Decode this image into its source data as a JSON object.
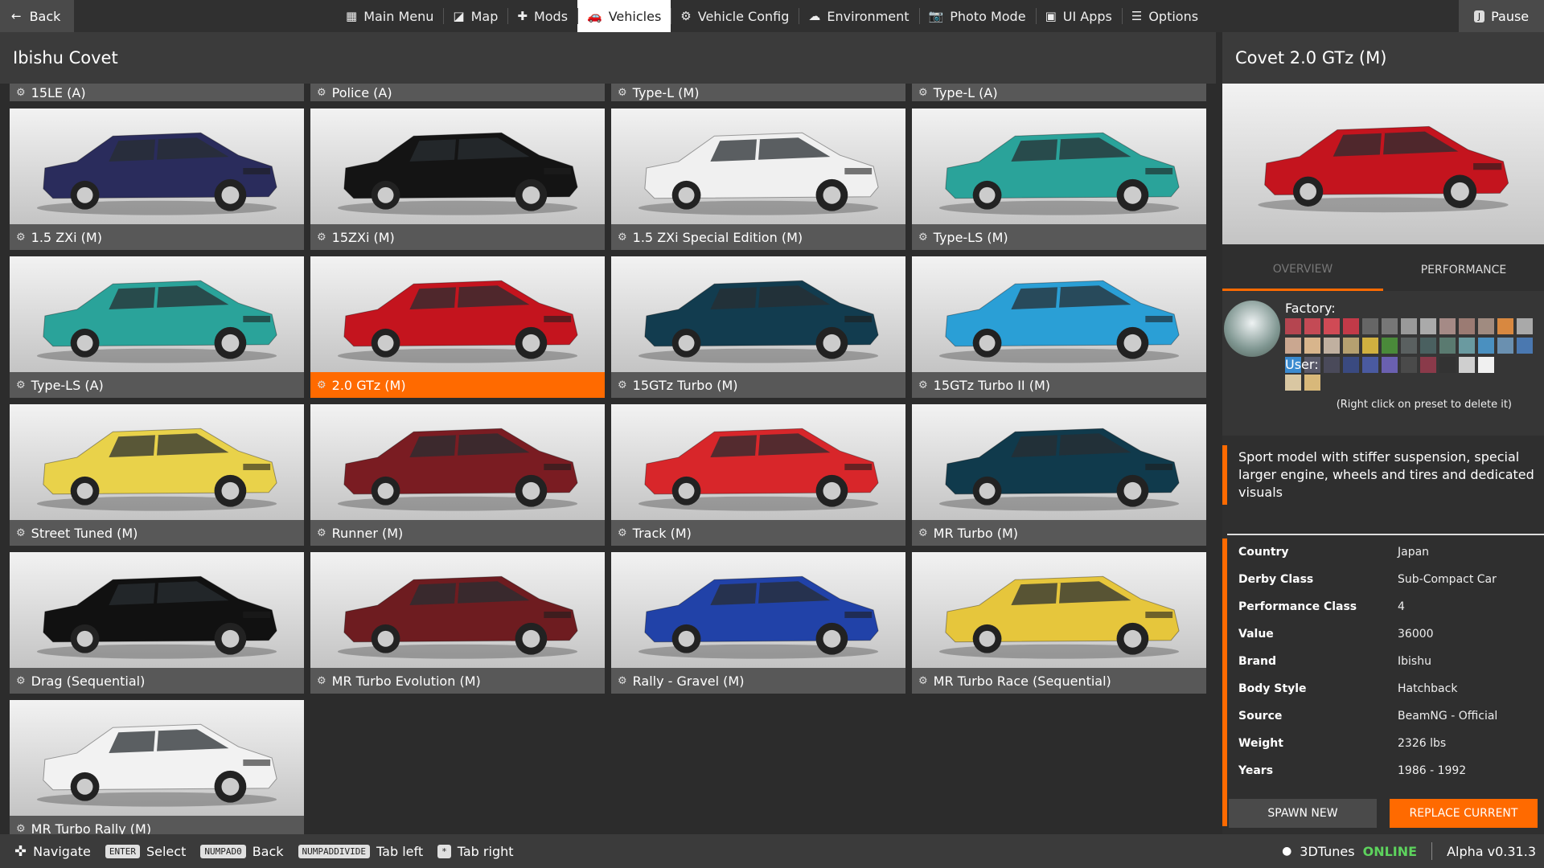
{
  "topbar": {
    "back_label": "Back",
    "pause_label": "Pause",
    "pause_key": "J",
    "tabs": [
      {
        "label": "Main Menu",
        "icon": "grid-icon",
        "glyph": "▦"
      },
      {
        "label": "Map",
        "icon": "map-icon",
        "glyph": "◪"
      },
      {
        "label": "Mods",
        "icon": "puzzle-icon",
        "glyph": "✚"
      },
      {
        "label": "Vehicles",
        "icon": "car-icon",
        "glyph": "🚗"
      },
      {
        "label": "Vehicle Config",
        "icon": "engine-icon",
        "glyph": "⚙"
      },
      {
        "label": "Environment",
        "icon": "weather-icon",
        "glyph": "☁"
      },
      {
        "label": "Photo Mode",
        "icon": "camera-icon",
        "glyph": "📷"
      },
      {
        "label": "UI Apps",
        "icon": "apps-icon",
        "glyph": "▣"
      },
      {
        "label": "Options",
        "icon": "sliders-icon",
        "glyph": "☰"
      }
    ]
  },
  "panel": {
    "title": "Ibishu Covet"
  },
  "configs": [
    {
      "name": "15LE (A)",
      "color": "#8a8a8a"
    },
    {
      "name": "Police (A)",
      "color": "#8a8a8a"
    },
    {
      "name": "Type-L (M)",
      "color": "#8a8a8a"
    },
    {
      "name": "Type-L (A)",
      "color": "#8a8a8a"
    },
    {
      "name": "1.5 ZXi (M)",
      "color": "#2a2c5c"
    },
    {
      "name": "15ZXi (M)",
      "color": "#141414"
    },
    {
      "name": "1.5 ZXi Special Edition (M)",
      "color": "#f0f0f0"
    },
    {
      "name": "Type-LS (M)",
      "color": "#2aa39a"
    },
    {
      "name": "Type-LS (A)",
      "color": "#2aa39a"
    },
    {
      "name": "2.0 GTz (M)",
      "color": "#c4141e"
    },
    {
      "name": "15GTz Turbo (M)",
      "color": "#123c4f"
    },
    {
      "name": "15GTz Turbo II (M)",
      "color": "#2a9fd6"
    },
    {
      "name": "Street Tuned (M)",
      "color": "#e9d24a"
    },
    {
      "name": "Runner (M)",
      "color": "#7a1c22"
    },
    {
      "name": "Track (M)",
      "color": "#d8262a"
    },
    {
      "name": "MR Turbo (M)",
      "color": "#103a4c"
    },
    {
      "name": "Drag (Sequential)",
      "color": "#111111"
    },
    {
      "name": "MR Turbo Evolution (M)",
      "color": "#6e1c20"
    },
    {
      "name": "Rally - Gravel (M)",
      "color": "#2142a8"
    },
    {
      "name": "MR Turbo Race (Sequential)",
      "color": "#e6c63c"
    },
    {
      "name": "MR Turbo Rally (M)",
      "color": "#f2f2f2"
    }
  ],
  "selected_index": 9,
  "side": {
    "title": "Covet 2.0 GTz (M)",
    "car_color": "#c4141e",
    "tabs": [
      "OVERVIEW",
      "PERFORMANCE"
    ],
    "factory_label": "Factory:",
    "user_label": "User:",
    "hint": "(Right click on preset to delete it)",
    "factory_colors": [
      "#b54550",
      "#c44a55",
      "#d04a55",
      "#c23a48",
      "#666",
      "#777",
      "#999",
      "#aaa",
      "#a58a86",
      "#9b7b73",
      "#a08b80",
      "#d88840",
      "#a9a9a9",
      "#caa790",
      "#d8b58c",
      "#c0b0a0",
      "#b5a070",
      "#d0b040",
      "#4a8a3a",
      "#5a6060",
      "#4a6060",
      "#5a7a70",
      "#6a9aa0",
      "#4a90c0",
      "#6a90b0",
      "#4a78b0",
      "#3a8ad0",
      "#5a5a6a",
      "#4a4a5a",
      "#3a4a80",
      "#4a5aa0",
      "#6a60b0",
      "#4a4a4a",
      "#8a3a4a",
      "#333",
      "#cfcfcf",
      "#f0f0f0"
    ],
    "user_colors": [
      "#d9c7a2",
      "#d8b87a"
    ],
    "description": "Sport model with stiffer suspension, special larger engine, wheels and tires and dedicated visuals",
    "specs": [
      {
        "k": "Country",
        "v": "Japan"
      },
      {
        "k": "Derby Class",
        "v": "Sub-Compact Car"
      },
      {
        "k": "Performance Class",
        "v": "4"
      },
      {
        "k": "Value",
        "v": "36000"
      },
      {
        "k": "Brand",
        "v": "Ibishu"
      },
      {
        "k": "Body Style",
        "v": "Hatchback"
      },
      {
        "k": "Source",
        "v": "BeamNG - Official"
      },
      {
        "k": "Weight",
        "v": "2326 lbs"
      },
      {
        "k": "Years",
        "v": "1986 - 1992"
      }
    ],
    "spawn_label": "SPAWN NEW",
    "replace_label": "REPLACE CURRENT"
  },
  "bottombar": {
    "hints": [
      {
        "key": "",
        "label": "Navigate",
        "icon": "dpad-icon"
      },
      {
        "key": "ENTER",
        "label": "Select"
      },
      {
        "key": "NUMPAD0",
        "label": "Back"
      },
      {
        "key": "NUMPADDIVIDE",
        "label": "Tab left"
      },
      {
        "key": "*",
        "label": "Tab right"
      }
    ],
    "user": "3DTunes",
    "online": "ONLINE",
    "version": "Alpha v0.31.3"
  }
}
